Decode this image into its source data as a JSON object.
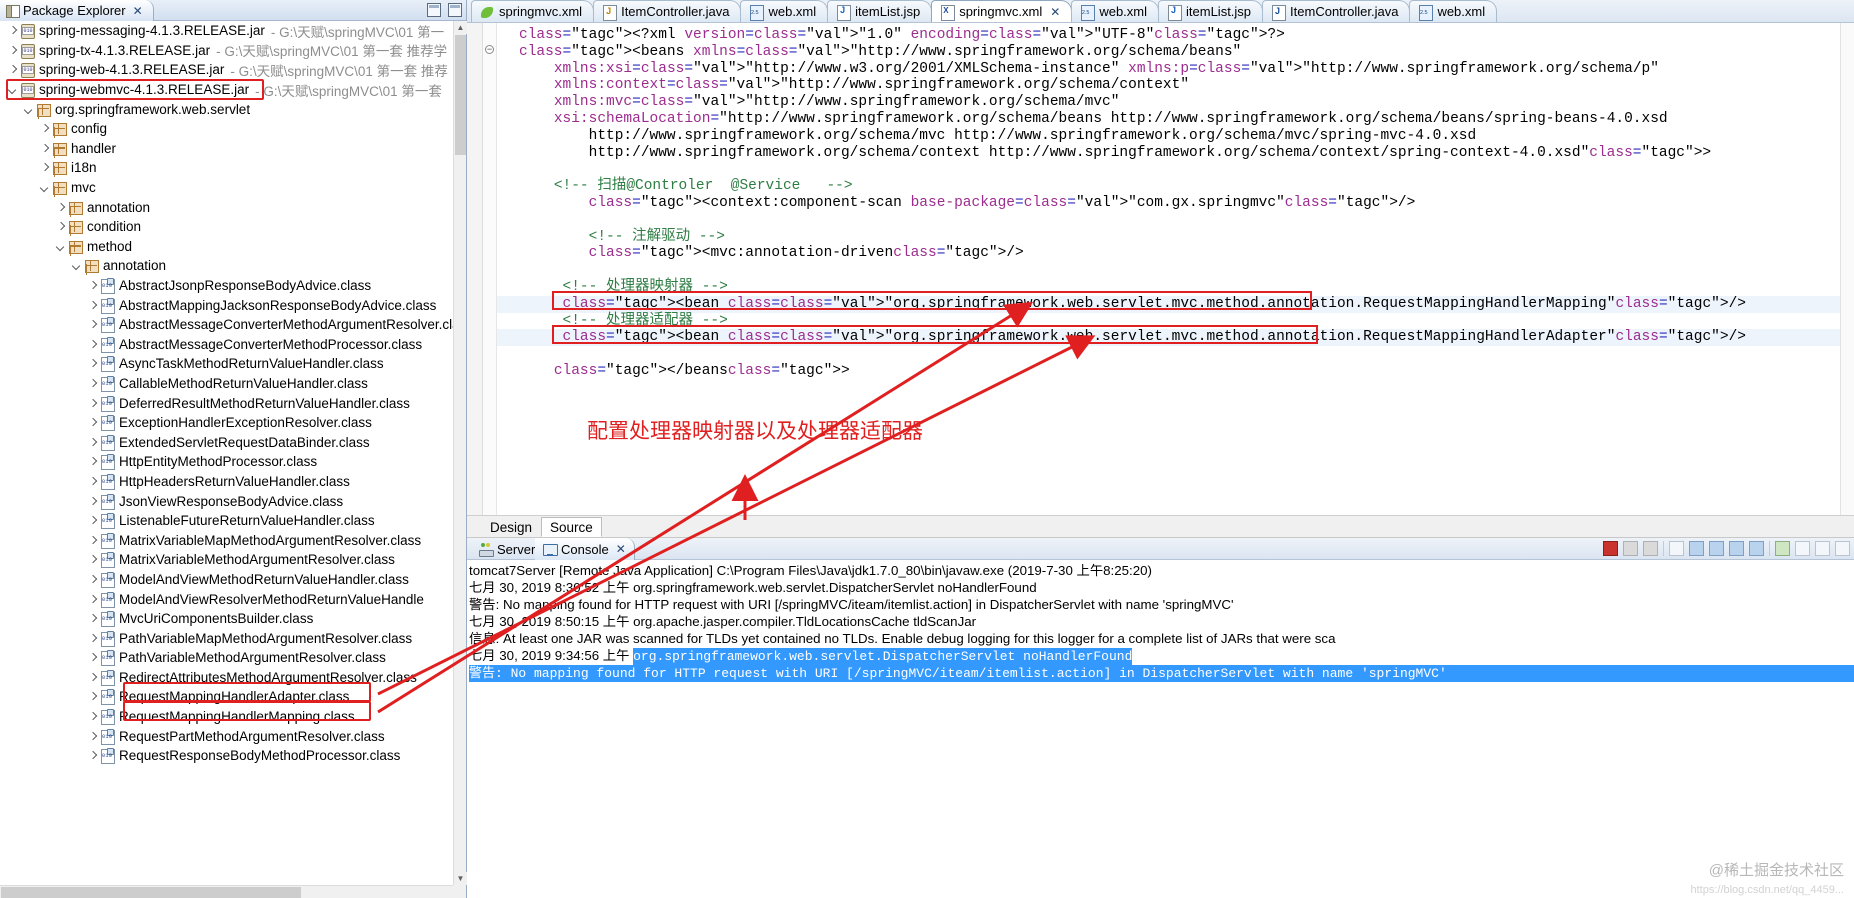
{
  "explorer": {
    "tab_title": "Package Explorer",
    "tab_icon": "package-explorer-icon",
    "close_glyph": "✕",
    "items": [
      {
        "indent": 0,
        "arrow": "collapsed",
        "icon": "jar-icon",
        "label": "spring-messaging-4.1.3.RELEASE.jar",
        "dim": "- G:\\天赋\\springMVC\\01 第一"
      },
      {
        "indent": 0,
        "arrow": "collapsed",
        "icon": "jar-icon",
        "label": "spring-tx-4.1.3.RELEASE.jar",
        "dim": "- G:\\天赋\\springMVC\\01 第一套 推荐学"
      },
      {
        "indent": 0,
        "arrow": "collapsed",
        "icon": "jar-icon",
        "label": "spring-web-4.1.3.RELEASE.jar",
        "dim": "- G:\\天赋\\springMVC\\01 第一套 推荐"
      },
      {
        "indent": 0,
        "arrow": "expanded",
        "icon": "jar-icon",
        "label": "spring-webmvc-4.1.3.RELEASE.jar",
        "dim": "- G:\\天赋\\springMVC\\01 第一套"
      },
      {
        "indent": 1,
        "arrow": "expanded",
        "icon": "package-icon",
        "label": "org.springframework.web.servlet",
        "dim": ""
      },
      {
        "indent": 2,
        "arrow": "collapsed",
        "icon": "package-icon",
        "label": "config",
        "dim": ""
      },
      {
        "indent": 2,
        "arrow": "collapsed",
        "icon": "package-icon",
        "label": "handler",
        "dim": ""
      },
      {
        "indent": 2,
        "arrow": "collapsed",
        "icon": "package-icon",
        "label": "i18n",
        "dim": ""
      },
      {
        "indent": 2,
        "arrow": "expanded",
        "icon": "package-icon",
        "label": "mvc",
        "dim": ""
      },
      {
        "indent": 3,
        "arrow": "collapsed",
        "icon": "package-icon",
        "label": "annotation",
        "dim": ""
      },
      {
        "indent": 3,
        "arrow": "collapsed",
        "icon": "package-icon",
        "label": "condition",
        "dim": ""
      },
      {
        "indent": 3,
        "arrow": "expanded",
        "icon": "package-icon",
        "label": "method",
        "dim": ""
      },
      {
        "indent": 4,
        "arrow": "expanded",
        "icon": "package-icon",
        "label": "annotation",
        "dim": ""
      },
      {
        "indent": 5,
        "arrow": "collapsed",
        "icon": "class-icon",
        "label": "AbstractJsonpResponseBodyAdvice.class",
        "dim": ""
      },
      {
        "indent": 5,
        "arrow": "collapsed",
        "icon": "class-icon",
        "label": "AbstractMappingJacksonResponseBodyAdvice.class",
        "dim": ""
      },
      {
        "indent": 5,
        "arrow": "collapsed",
        "icon": "class-icon",
        "label": "AbstractMessageConverterMethodArgumentResolver.class",
        "dim": ""
      },
      {
        "indent": 5,
        "arrow": "collapsed",
        "icon": "class-icon",
        "label": "AbstractMessageConverterMethodProcessor.class",
        "dim": ""
      },
      {
        "indent": 5,
        "arrow": "collapsed",
        "icon": "class-icon",
        "label": "AsyncTaskMethodReturnValueHandler.class",
        "dim": ""
      },
      {
        "indent": 5,
        "arrow": "collapsed",
        "icon": "class-icon",
        "label": "CallableMethodReturnValueHandler.class",
        "dim": ""
      },
      {
        "indent": 5,
        "arrow": "collapsed",
        "icon": "class-icon",
        "label": "DeferredResultMethodReturnValueHandler.class",
        "dim": ""
      },
      {
        "indent": 5,
        "arrow": "collapsed",
        "icon": "class-icon",
        "label": "ExceptionHandlerExceptionResolver.class",
        "dim": ""
      },
      {
        "indent": 5,
        "arrow": "collapsed",
        "icon": "class-icon",
        "label": "ExtendedServletRequestDataBinder.class",
        "dim": ""
      },
      {
        "indent": 5,
        "arrow": "collapsed",
        "icon": "class-icon",
        "label": "HttpEntityMethodProcessor.class",
        "dim": ""
      },
      {
        "indent": 5,
        "arrow": "collapsed",
        "icon": "class-icon",
        "label": "HttpHeadersReturnValueHandler.class",
        "dim": ""
      },
      {
        "indent": 5,
        "arrow": "collapsed",
        "icon": "class-icon",
        "label": "JsonViewResponseBodyAdvice.class",
        "dim": ""
      },
      {
        "indent": 5,
        "arrow": "collapsed",
        "icon": "class-icon",
        "label": "ListenableFutureReturnValueHandler.class",
        "dim": ""
      },
      {
        "indent": 5,
        "arrow": "collapsed",
        "icon": "class-icon",
        "label": "MatrixVariableMapMethodArgumentResolver.class",
        "dim": ""
      },
      {
        "indent": 5,
        "arrow": "collapsed",
        "icon": "class-icon",
        "label": "MatrixVariableMethodArgumentResolver.class",
        "dim": ""
      },
      {
        "indent": 5,
        "arrow": "collapsed",
        "icon": "class-icon",
        "label": "ModelAndViewMethodReturnValueHandler.class",
        "dim": ""
      },
      {
        "indent": 5,
        "arrow": "collapsed",
        "icon": "class-icon",
        "label": "ModelAndViewResolverMethodReturnValueHandle",
        "dim": ""
      },
      {
        "indent": 5,
        "arrow": "collapsed",
        "icon": "class-icon",
        "label": "MvcUriComponentsBuilder.class",
        "dim": ""
      },
      {
        "indent": 5,
        "arrow": "collapsed",
        "icon": "class-icon",
        "label": "PathVariableMapMethodArgumentResolver.class",
        "dim": ""
      },
      {
        "indent": 5,
        "arrow": "collapsed",
        "icon": "class-icon",
        "label": "PathVariableMethodArgumentResolver.class",
        "dim": ""
      },
      {
        "indent": 5,
        "arrow": "collapsed",
        "icon": "class-icon",
        "label": "RedirectAttributesMethodArgumentResolver.class",
        "dim": ""
      },
      {
        "indent": 5,
        "arrow": "collapsed",
        "icon": "class-icon",
        "label": "RequestMappingHandlerAdapter.class",
        "dim": ""
      },
      {
        "indent": 5,
        "arrow": "collapsed",
        "icon": "class-icon",
        "label": "RequestMappingHandlerMapping.class",
        "dim": ""
      },
      {
        "indent": 5,
        "arrow": "collapsed",
        "icon": "class-icon",
        "label": "RequestPartMethodArgumentResolver.class",
        "dim": ""
      },
      {
        "indent": 5,
        "arrow": "collapsed",
        "icon": "class-icon",
        "label": "RequestResponseBodyMethodProcessor.class",
        "dim": ""
      }
    ]
  },
  "editor_tabs": [
    {
      "label": "springmvc.xml",
      "icon": "xml-leaf-icon",
      "icon_kind": "fi-leaf",
      "active": false
    },
    {
      "label": "ItemController.java",
      "icon": "java-warn-icon",
      "icon_kind": "fi-java warn",
      "active": false
    },
    {
      "label": "web.xml",
      "icon": "web-xml-icon",
      "icon_kind": "fi-web",
      "active": false
    },
    {
      "label": "itemList.jsp",
      "icon": "jsp-icon",
      "icon_kind": "fi-jsp",
      "active": false
    },
    {
      "label": "springmvc.xml",
      "icon": "xml-icon",
      "icon_kind": "fi-xml",
      "active": true
    },
    {
      "label": "web.xml",
      "icon": "web-xml-icon",
      "icon_kind": "fi-web",
      "active": false
    },
    {
      "label": "itemList.jsp",
      "icon": "jsp-icon",
      "icon_kind": "fi-jsp",
      "active": false
    },
    {
      "label": "ItemController.java",
      "icon": "java-icon",
      "icon_kind": "fi-java",
      "active": false
    },
    {
      "label": "web.xml",
      "icon": "web-xml-icon",
      "icon_kind": "fi-web",
      "active": false
    }
  ],
  "editor": {
    "active_close_glyph": "✕",
    "annotation": "配置处理器映射器以及处理器适配器",
    "code_lines": [
      "<?xml version=\"1.0\" encoding=\"UTF-8\"?>",
      "<beans xmlns=\"http://www.springframework.org/schema/beans\"",
      "    xmlns:xsi=\"http://www.w3.org/2001/XMLSchema-instance\" xmlns:p=\"http://www.springframework.org/schema/p\"",
      "    xmlns:context=\"http://www.springframework.org/schema/context\"",
      "    xmlns:mvc=\"http://www.springframework.org/schema/mvc\"",
      "    xsi:schemaLocation=\"http://www.springframework.org/schema/beans http://www.springframework.org/schema/beans/spring-beans-4.0.xsd",
      "        http://www.springframework.org/schema/mvc http://www.springframework.org/schema/mvc/spring-mvc-4.0.xsd",
      "        http://www.springframework.org/schema/context http://www.springframework.org/schema/context/spring-context-4.0.xsd\">",
      "",
      "    <!-- 扫描@Controler  @Service   -->",
      "        <context:component-scan base-package=\"com.gx.springmvc\"/>",
      "",
      "        <!-- 注解驱动 -->",
      "        <mvc:annotation-driven/>",
      "",
      "     <!-- 处理器映射器 -->",
      "     <bean class=\"org.springframework.web.servlet.mvc.method.annotation.RequestMappingHandlerMapping\"/>",
      "     <!-- 处理器适配器 -->",
      "     <bean class=\"org.springframework.web.servlet.mvc.method.annotation.RequestMappingHandlerAdapter\"/>",
      "",
      "    </beans>"
    ]
  },
  "design_source_tabs": [
    {
      "label": "Design",
      "active": false
    },
    {
      "label": "Source",
      "active": true
    }
  ],
  "bottom_view": {
    "tabs": [
      {
        "label": "Servers",
        "icon": "servers-icon",
        "active": false
      },
      {
        "label": "Console",
        "icon": "console-icon",
        "active": true,
        "close_glyph": "✕"
      }
    ],
    "toolbar_icons": [
      "terminate-icon",
      "remove-launch-icon",
      "remove-all-terminated-icon",
      "clear-console-icon",
      "scroll-lock-icon",
      "word-wrap-icon",
      "pin-console-icon",
      "display-selected-console-icon",
      "open-console-icon",
      "minimize-icon",
      "maximize-icon"
    ],
    "header": "tomcat7Server [Remote Java Application] C:\\Program Files\\Java\\jdk1.7.0_80\\bin\\javaw.exe (2019-7-30 上午8:25:20)",
    "lines": [
      {
        "text": "七月 30, 2019 8:30:52 上午 org.springframework.web.servlet.DispatcherServlet noHandlerFound",
        "style": "plain"
      },
      {
        "text": "警告: No mapping found for HTTP request with URI [/springMVC/iteam/itemlist.action] in DispatcherServlet with name 'springMVC'",
        "style": "plain"
      },
      {
        "text": "七月 30, 2019 8:50:15 上午 org.apache.jasper.compiler.TldLocationsCache tldScanJar",
        "style": "plain"
      },
      {
        "text": "信息: At least one JAR was scanned for TLDs yet contained no TLDs. Enable debug logging for this logger for a complete list of JARs that were sca",
        "style": "plain"
      },
      {
        "text": "七月 30, 2019 9:34:56 上午 ",
        "style": "plain",
        "selected_suffix": "org.springframework.web.servlet.DispatcherServlet noHandlerFound"
      },
      {
        "text": "警告: No mapping found for HTTP request with URI [/springMVC/iteam/itemlist.action] in DispatcherServlet with name 'springMVC'",
        "style": "selected"
      }
    ]
  },
  "watermark": {
    "line1": "@稀土掘金技术社区",
    "line2": "https://blog.csdn.net/qq_4459..."
  },
  "colors": {
    "highlight_red": "#e02020",
    "selection_blue": "#3399ff",
    "tag_blue": "#2b2bbd",
    "attr_purple": "#9c2d8f",
    "comment_green": "#2e7d43",
    "string_blue": "#2f2fbd"
  }
}
